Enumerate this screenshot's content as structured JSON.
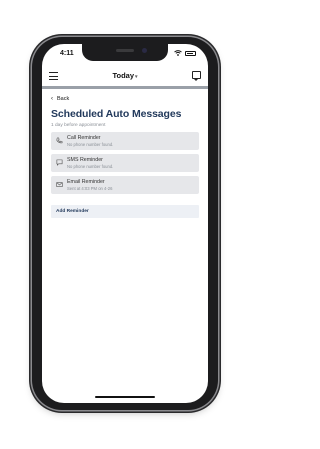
{
  "status_bar": {
    "time": "4:11"
  },
  "navbar": {
    "title": "Today",
    "title_caret": "▾"
  },
  "content": {
    "back_label": "Back",
    "title": "Scheduled Auto Messages",
    "subtitle": "1 day before appointment",
    "reminders": [
      {
        "icon": "phone-icon",
        "title": "Call Reminder",
        "detail": "No phone number found."
      },
      {
        "icon": "sms-icon",
        "title": "SMS Reminder",
        "detail": "No phone number found."
      },
      {
        "icon": "email-icon",
        "title": "Email Reminder",
        "detail": "Sent at 4:03 PM on 4-26"
      }
    ],
    "add_reminder_label": "Add Reminder"
  },
  "colors": {
    "title": "#233a5c",
    "card_bg": "#e6e7ea",
    "add_bg": "#edf0f5",
    "divider": "#9aa0a8"
  }
}
